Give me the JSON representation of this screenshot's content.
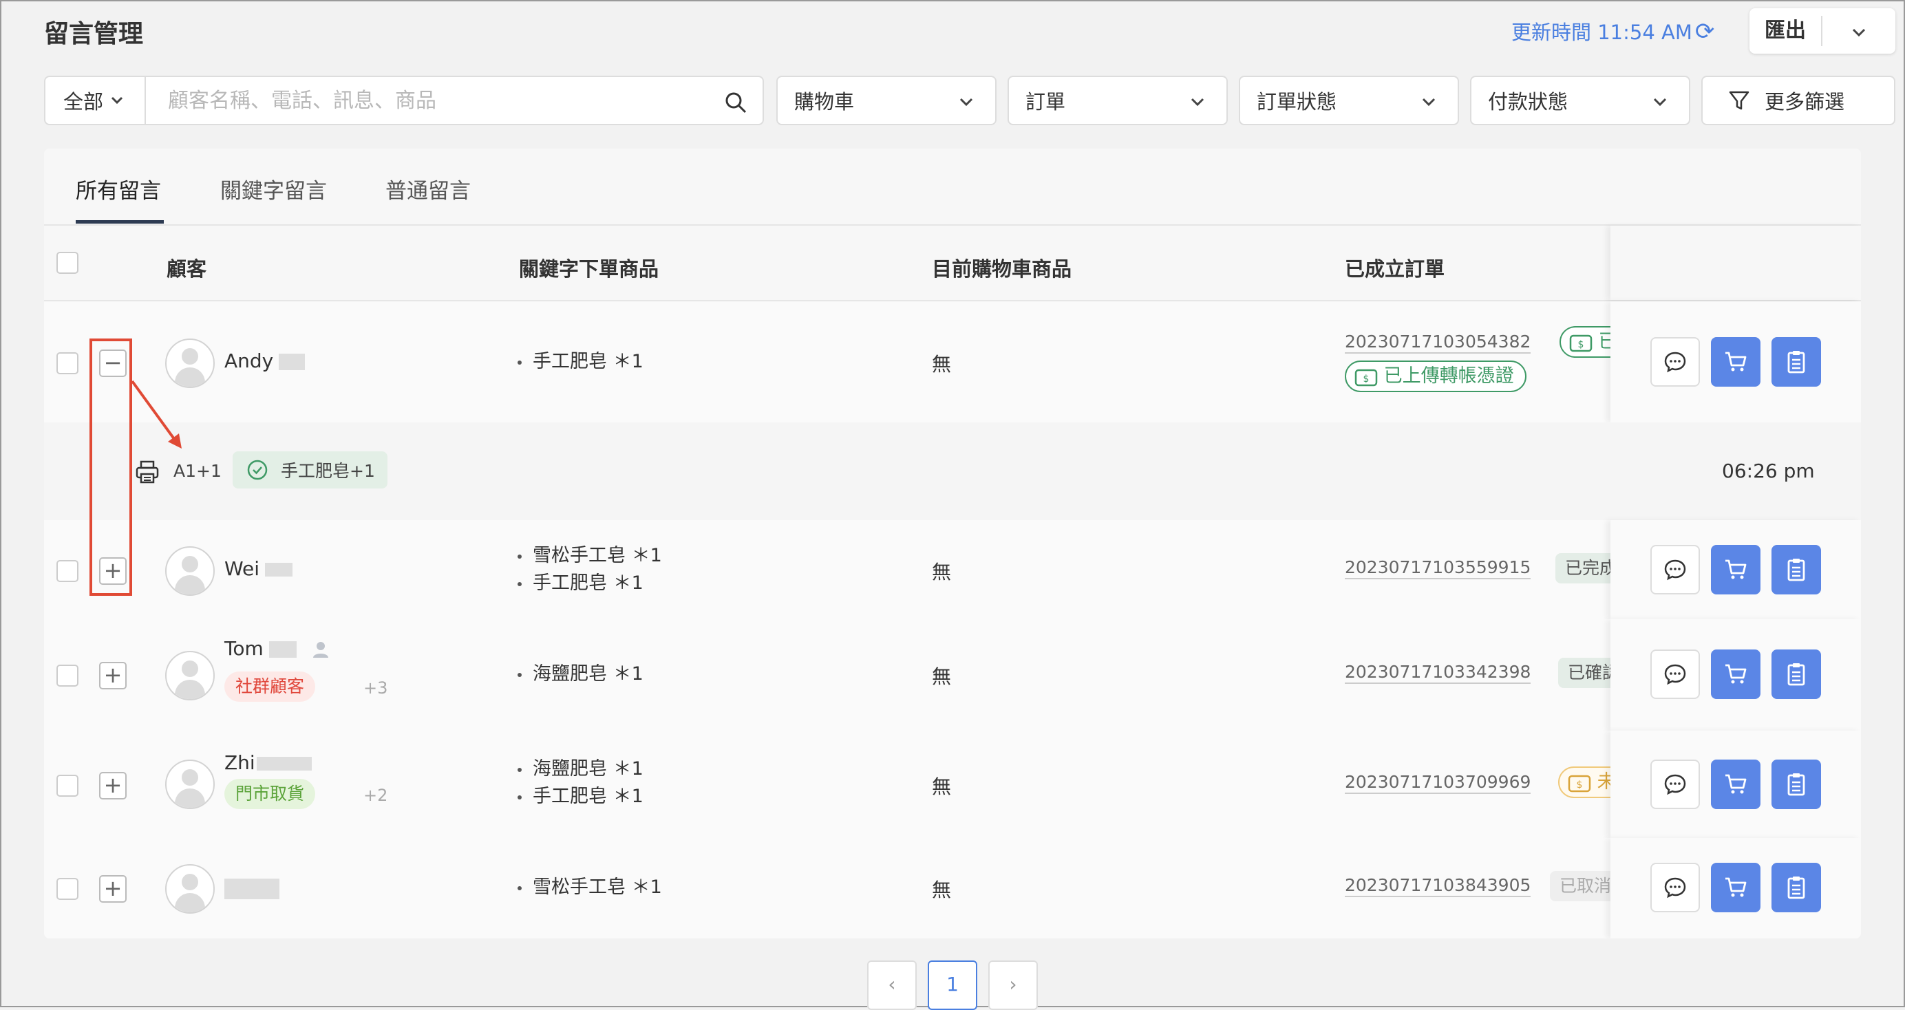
{
  "header": {
    "title": "留言管理",
    "update_label": "更新時間 11:54 AM",
    "export_label": "匯出"
  },
  "filters": {
    "scope": "全部",
    "search_placeholder": "顧客名稱、電話、訊息、商品",
    "cart": "購物車",
    "order": "訂單",
    "order_status": "訂單狀態",
    "payment_status": "付款狀態",
    "more": "更多篩選"
  },
  "tabs": [
    "所有留言",
    "關鍵字留言",
    "普通留言"
  ],
  "columns": {
    "customer": "顧客",
    "keyword_items": "關鍵字下單商品",
    "cart_items": "目前購物車商品",
    "orders": "已成立訂單"
  },
  "rows": [
    {
      "name": "Andy",
      "items": [
        "手工肥皂 ＊1"
      ],
      "cart": "無",
      "order_no": "20230717103054382",
      "status": "已付款",
      "status2": "已上傳轉帳憑證",
      "expanded": {
        "keyword": "A1+1",
        "chip": "手工肥皂+1",
        "time": "06:26 pm"
      }
    },
    {
      "name": "Wei",
      "items": [
        "雪松手工皂 ＊1",
        "手工肥皂 ＊1"
      ],
      "cart": "無",
      "order_no": "20230717103559915",
      "status": "已完成"
    },
    {
      "name": "Tom",
      "tag": "社群顧客",
      "tag_more": "+3",
      "items": [
        "海鹽肥皂 ＊1"
      ],
      "cart": "無",
      "order_no": "20230717103342398",
      "status": "已確認"
    },
    {
      "name": "Zhi",
      "tag": "門市取貨",
      "tag_more": "+2",
      "items": [
        "海鹽肥皂 ＊1",
        "手工肥皂 ＊1"
      ],
      "cart": "無",
      "order_no": "20230717103709969",
      "status": "未付款"
    },
    {
      "name": "",
      "items": [
        "雪松手工皂 ＊1"
      ],
      "cart": "無",
      "order_no": "20230717103843905",
      "status": "已取消"
    }
  ],
  "pagination": {
    "prev": "‹",
    "current": "1",
    "next": "›"
  },
  "colors": {
    "accent": "#5b86e6",
    "link_blue": "#4a7fe0",
    "paid_green": "#3f9a66",
    "unpaid_orange": "#d9a43a",
    "highlight_red": "#e04a35"
  }
}
